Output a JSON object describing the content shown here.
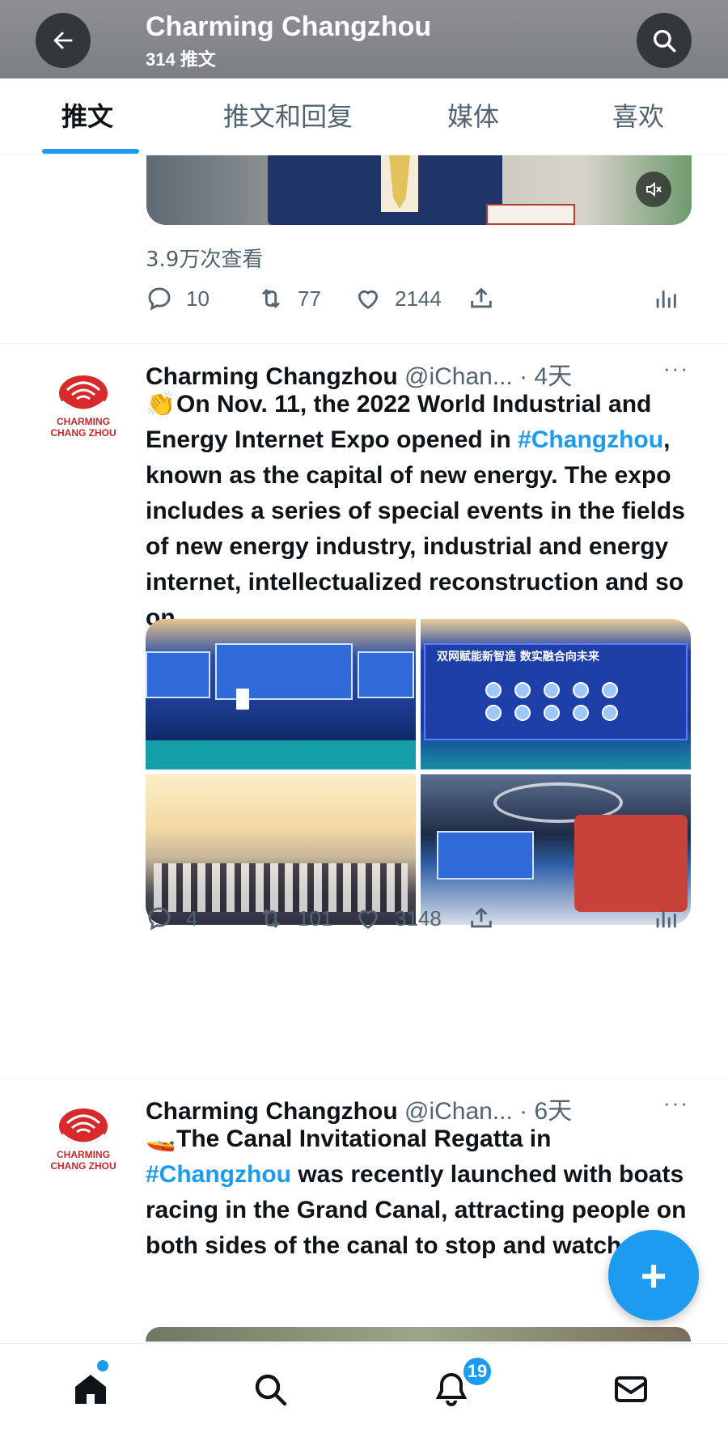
{
  "header": {
    "title": "Charming Changzhou",
    "subtitle": "314 推文",
    "back_icon": "arrow-left-icon",
    "search_icon": "search-icon"
  },
  "tabs": [
    {
      "label": "推文",
      "active": true
    },
    {
      "label": "推文和回复",
      "active": false
    },
    {
      "label": "媒体",
      "active": false
    },
    {
      "label": "喜欢",
      "active": false
    }
  ],
  "colors": {
    "accent": "#1d9bf0",
    "text_primary": "#0f1419",
    "text_secondary": "#536471",
    "brand_red": "#c6282b"
  },
  "tweet0": {
    "views": "3.9万次查看",
    "replies": "10",
    "retweets": "77",
    "likes": "2144",
    "mute_icon": "volume-mute-icon"
  },
  "tweet1": {
    "avatar_text_line1": "CHARMING",
    "avatar_text_line2": "CHANG ZHOU",
    "name": "Charming Changzhou",
    "handle": "@iChan... · 4天",
    "more": "···",
    "emoji": "👏",
    "text_part1": "On Nov. 11, the 2022 World Industrial and Energy Internet Expo opened in ",
    "hashtag": "#Changzhou",
    "text_part2": ", known as the capital of new energy. The expo includes a series of special events in the fields of new energy industry, industrial and energy internet, intellectualized reconstruction and so on.",
    "replies": "4",
    "retweets": "101",
    "likes": "3148",
    "banner_text": "双网赋能新智造 数实融合向未来"
  },
  "tweet2": {
    "avatar_text_line1": "CHARMING",
    "avatar_text_line2": "CHANG ZHOU",
    "name": "Charming Changzhou",
    "handle": "@iChan... · 6天",
    "more": "···",
    "emoji": "🚤",
    "text_part1": "The Canal Invitational Regatta in ",
    "hashtag": "#Changzhou",
    "text_part2": " was recently launched with boats racing in the Grand Canal, attracting people on both sides of the canal to stop and watch."
  },
  "fab": {
    "label": "+"
  },
  "bottom_nav": {
    "home_icon": "home-icon",
    "search_icon": "search-icon",
    "notifications_icon": "bell-icon",
    "notifications_badge": "19",
    "messages_icon": "mail-icon"
  }
}
